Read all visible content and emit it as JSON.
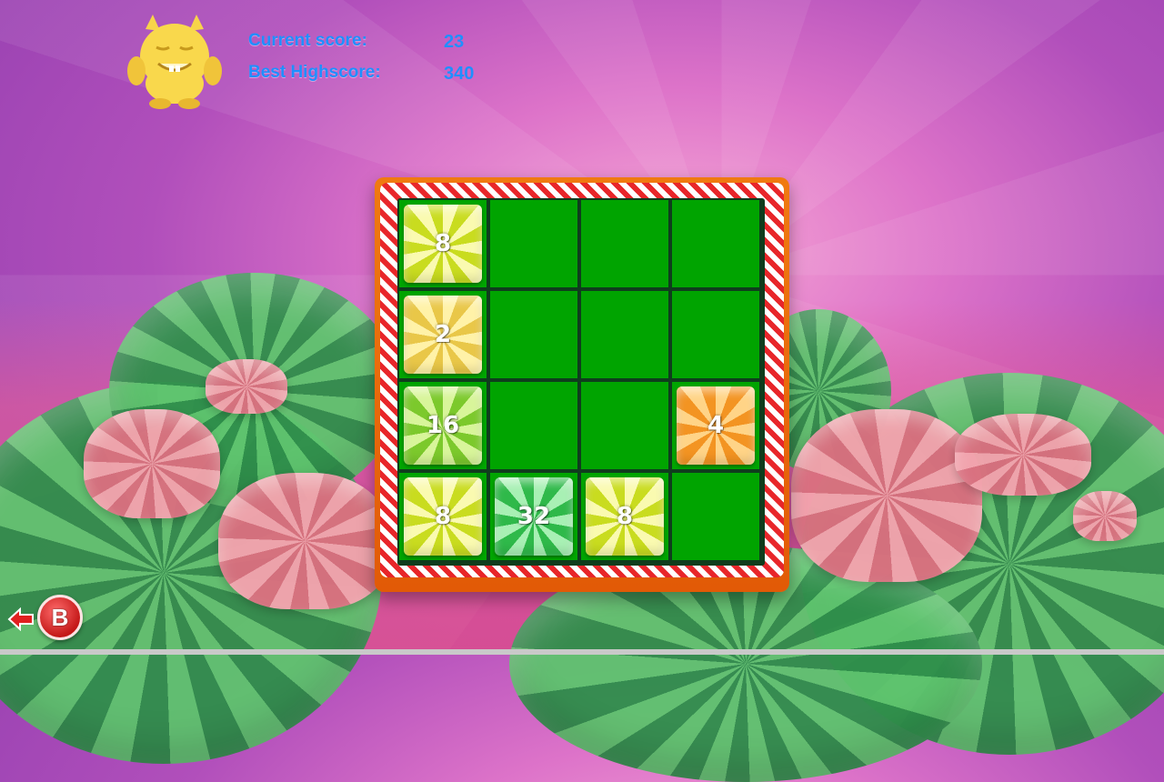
{
  "hud": {
    "current_score_label": "Current score:",
    "current_score_value": "23",
    "best_highscore_label": "Best Highscore:",
    "best_highscore_value": "340"
  },
  "board": {
    "size": 4,
    "rows": [
      [
        "8",
        "",
        "",
        ""
      ],
      [
        "2",
        "",
        "",
        ""
      ],
      [
        "16",
        "",
        "",
        "4"
      ],
      [
        "8",
        "32",
        "8",
        ""
      ]
    ]
  },
  "controls": {
    "back_button_label": "B"
  },
  "icons": {
    "mascot": "yellow-monster-icon",
    "back_arrow": "left-arrow-icon"
  },
  "colors": {
    "hud_text": "#1f8fff",
    "board_cell": "#00a400",
    "frame": "#f07a10",
    "back_button": "#d82020"
  }
}
